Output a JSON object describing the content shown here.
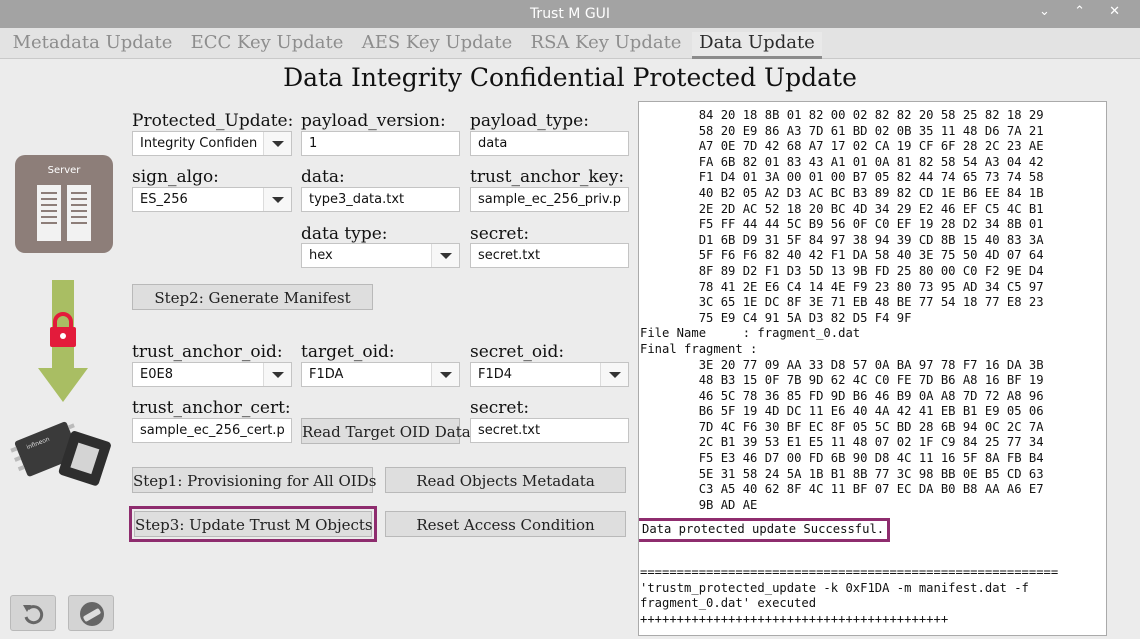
{
  "window": {
    "title": "Trust M GUI",
    "controls": "⌄ ⌃ ✕"
  },
  "tabs": [
    {
      "label": "Metadata Update"
    },
    {
      "label": "ECC Key Update"
    },
    {
      "label": "AES Key Update"
    },
    {
      "label": "RSA Key Update"
    },
    {
      "label": "Data Update",
      "active": true
    }
  ],
  "page_title": "Data Integrity Confidential Protected Update",
  "illustration": {
    "server_label": "Server",
    "chip_label": "infineon"
  },
  "form": {
    "protected_update": {
      "label": "Protected_Update:",
      "value": "Integrity Confiden"
    },
    "payload_version": {
      "label": "payload_version:",
      "value": "1"
    },
    "payload_type": {
      "label": "payload_type:",
      "value": "data"
    },
    "sign_algo": {
      "label": "sign_algo:",
      "value": "ES_256"
    },
    "data": {
      "label": "data:",
      "value": "type3_data.txt"
    },
    "trust_anchor_key": {
      "label": "trust_anchor_key:",
      "value": "sample_ec_256_priv.p"
    },
    "data_type": {
      "label": "data type:",
      "value": "hex"
    },
    "secret_1": {
      "label": "secret:",
      "value": "secret.txt"
    },
    "trust_anchor_oid": {
      "label": "trust_anchor_oid:",
      "value": "E0E8"
    },
    "target_oid": {
      "label": "target_oid:",
      "value": "F1DA"
    },
    "secret_oid": {
      "label": "secret_oid:",
      "value": "F1D4"
    },
    "trust_anchor_cert": {
      "label": "trust_anchor_cert:",
      "value": "sample_ec_256_cert.p"
    },
    "secret_2": {
      "label": "secret:",
      "value": "secret.txt"
    }
  },
  "buttons": {
    "step2": "Step2: Generate Manifest",
    "read_target": "Read Target OID Data",
    "step1": "Step1: Provisioning for All OIDs",
    "read_meta": "Read Objects Metadata",
    "step3": "Step3: Update Trust M Objects",
    "reset": "Reset Access Condition"
  },
  "console": {
    "text": "        84 20 18 8B 01 82 00 02 82 82 20 58 25 82 18 29\n        58 20 E9 86 A3 7D 61 BD 02 0B 35 11 48 D6 7A 21\n        A7 0E 7D 42 68 A7 17 02 CA 19 CF 6F 28 2C 23 AE\n        FA 6B 82 01 83 43 A1 01 0A 81 82 58 54 A3 04 42\n        F1 D4 01 3A 00 01 00 B7 05 82 44 74 65 73 74 58\n        40 B2 05 A2 D3 AC BC B3 89 82 CD 1E B6 EE 84 1B\n        2E 2D AC 52 18 20 BC 4D 34 29 E2 46 EF C5 4C B1\n        F5 FF 44 44 5C B9 56 0F C0 EF 19 28 D2 34 8B 01\n        D1 6B D9 31 5F 84 97 38 94 39 CD 8B 15 40 83 3A\n        5F F6 F6 82 40 42 F1 DA 58 40 3E 75 50 4D 07 64\n        8F 89 D2 F1 D3 5D 13 9B FD 25 80 00 C0 F2 9E D4\n        78 41 2E E6 C4 14 4E F9 23 80 73 95 AD 34 C5 97\n        3C 65 1E DC 8F 3E 71 EB 48 BE 77 54 18 77 E8 23\n        75 E9 C4 91 5A D3 82 D5 F4 9F\nFile Name     : fragment_0.dat\nFinal fragment :\n        3E 20 77 09 AA 33 D8 57 0A BA 97 78 F7 16 DA 3B\n        48 B3 15 0F 7B 9D 62 4C C0 FE 7D B6 A8 16 BF 19\n        46 5C 78 36 85 FD 9D B6 46 B9 0A A8 7D 72 A8 96\n        B6 5F 19 4D DC 11 E6 40 4A 42 41 EB B1 E9 05 06\n        7D 4C F6 30 BF EC 8F 05 5C BD 28 6B 94 0C 2C 7A\n        2C B1 39 53 E1 E5 11 48 07 02 1F C9 84 25 77 34\n        F5 E3 46 D7 00 FD 6B 90 D8 4C 11 16 5F 8A FB B4\n        5E 31 58 24 5A 1B B1 8B 77 3C 98 BB 0E B5 CD 63\n        C3 A5 40 62 8F 4C 11 BF 07 EC DA B0 B8 AA A6 E7\n        9B AD AE",
    "success": "Data protected update Successful.",
    "tail": "\n\n=========================================================\n'trustm_protected_update -k 0xF1DA -m manifest.dat -f\nfragment_0.dat' executed\n++++++++++++++++++++++++++++++++++++++++++"
  }
}
